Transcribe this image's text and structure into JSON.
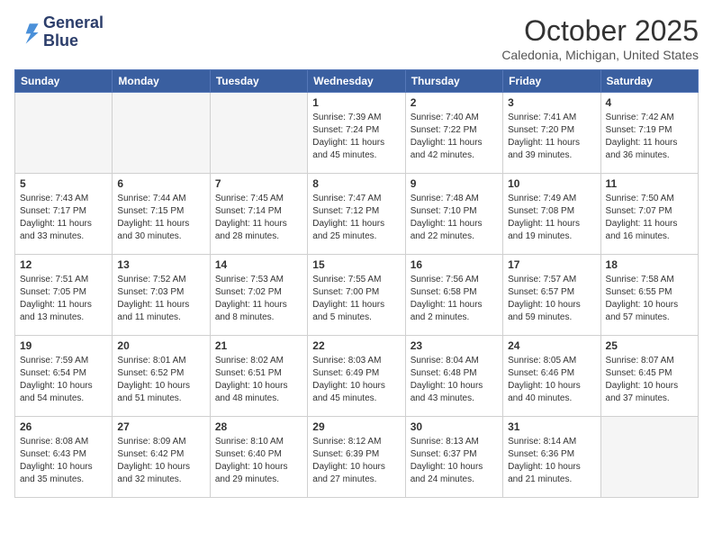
{
  "header": {
    "logo_line1": "General",
    "logo_line2": "Blue",
    "month": "October 2025",
    "location": "Caledonia, Michigan, United States"
  },
  "weekdays": [
    "Sunday",
    "Monday",
    "Tuesday",
    "Wednesday",
    "Thursday",
    "Friday",
    "Saturday"
  ],
  "weeks": [
    [
      {
        "day": "",
        "sunrise": "",
        "sunset": "",
        "daylight": ""
      },
      {
        "day": "",
        "sunrise": "",
        "sunset": "",
        "daylight": ""
      },
      {
        "day": "",
        "sunrise": "",
        "sunset": "",
        "daylight": ""
      },
      {
        "day": "1",
        "sunrise": "Sunrise: 7:39 AM",
        "sunset": "Sunset: 7:24 PM",
        "daylight": "Daylight: 11 hours and 45 minutes."
      },
      {
        "day": "2",
        "sunrise": "Sunrise: 7:40 AM",
        "sunset": "Sunset: 7:22 PM",
        "daylight": "Daylight: 11 hours and 42 minutes."
      },
      {
        "day": "3",
        "sunrise": "Sunrise: 7:41 AM",
        "sunset": "Sunset: 7:20 PM",
        "daylight": "Daylight: 11 hours and 39 minutes."
      },
      {
        "day": "4",
        "sunrise": "Sunrise: 7:42 AM",
        "sunset": "Sunset: 7:19 PM",
        "daylight": "Daylight: 11 hours and 36 minutes."
      }
    ],
    [
      {
        "day": "5",
        "sunrise": "Sunrise: 7:43 AM",
        "sunset": "Sunset: 7:17 PM",
        "daylight": "Daylight: 11 hours and 33 minutes."
      },
      {
        "day": "6",
        "sunrise": "Sunrise: 7:44 AM",
        "sunset": "Sunset: 7:15 PM",
        "daylight": "Daylight: 11 hours and 30 minutes."
      },
      {
        "day": "7",
        "sunrise": "Sunrise: 7:45 AM",
        "sunset": "Sunset: 7:14 PM",
        "daylight": "Daylight: 11 hours and 28 minutes."
      },
      {
        "day": "8",
        "sunrise": "Sunrise: 7:47 AM",
        "sunset": "Sunset: 7:12 PM",
        "daylight": "Daylight: 11 hours and 25 minutes."
      },
      {
        "day": "9",
        "sunrise": "Sunrise: 7:48 AM",
        "sunset": "Sunset: 7:10 PM",
        "daylight": "Daylight: 11 hours and 22 minutes."
      },
      {
        "day": "10",
        "sunrise": "Sunrise: 7:49 AM",
        "sunset": "Sunset: 7:08 PM",
        "daylight": "Daylight: 11 hours and 19 minutes."
      },
      {
        "day": "11",
        "sunrise": "Sunrise: 7:50 AM",
        "sunset": "Sunset: 7:07 PM",
        "daylight": "Daylight: 11 hours and 16 minutes."
      }
    ],
    [
      {
        "day": "12",
        "sunrise": "Sunrise: 7:51 AM",
        "sunset": "Sunset: 7:05 PM",
        "daylight": "Daylight: 11 hours and 13 minutes."
      },
      {
        "day": "13",
        "sunrise": "Sunrise: 7:52 AM",
        "sunset": "Sunset: 7:03 PM",
        "daylight": "Daylight: 11 hours and 11 minutes."
      },
      {
        "day": "14",
        "sunrise": "Sunrise: 7:53 AM",
        "sunset": "Sunset: 7:02 PM",
        "daylight": "Daylight: 11 hours and 8 minutes."
      },
      {
        "day": "15",
        "sunrise": "Sunrise: 7:55 AM",
        "sunset": "Sunset: 7:00 PM",
        "daylight": "Daylight: 11 hours and 5 minutes."
      },
      {
        "day": "16",
        "sunrise": "Sunrise: 7:56 AM",
        "sunset": "Sunset: 6:58 PM",
        "daylight": "Daylight: 11 hours and 2 minutes."
      },
      {
        "day": "17",
        "sunrise": "Sunrise: 7:57 AM",
        "sunset": "Sunset: 6:57 PM",
        "daylight": "Daylight: 10 hours and 59 minutes."
      },
      {
        "day": "18",
        "sunrise": "Sunrise: 7:58 AM",
        "sunset": "Sunset: 6:55 PM",
        "daylight": "Daylight: 10 hours and 57 minutes."
      }
    ],
    [
      {
        "day": "19",
        "sunrise": "Sunrise: 7:59 AM",
        "sunset": "Sunset: 6:54 PM",
        "daylight": "Daylight: 10 hours and 54 minutes."
      },
      {
        "day": "20",
        "sunrise": "Sunrise: 8:01 AM",
        "sunset": "Sunset: 6:52 PM",
        "daylight": "Daylight: 10 hours and 51 minutes."
      },
      {
        "day": "21",
        "sunrise": "Sunrise: 8:02 AM",
        "sunset": "Sunset: 6:51 PM",
        "daylight": "Daylight: 10 hours and 48 minutes."
      },
      {
        "day": "22",
        "sunrise": "Sunrise: 8:03 AM",
        "sunset": "Sunset: 6:49 PM",
        "daylight": "Daylight: 10 hours and 45 minutes."
      },
      {
        "day": "23",
        "sunrise": "Sunrise: 8:04 AM",
        "sunset": "Sunset: 6:48 PM",
        "daylight": "Daylight: 10 hours and 43 minutes."
      },
      {
        "day": "24",
        "sunrise": "Sunrise: 8:05 AM",
        "sunset": "Sunset: 6:46 PM",
        "daylight": "Daylight: 10 hours and 40 minutes."
      },
      {
        "day": "25",
        "sunrise": "Sunrise: 8:07 AM",
        "sunset": "Sunset: 6:45 PM",
        "daylight": "Daylight: 10 hours and 37 minutes."
      }
    ],
    [
      {
        "day": "26",
        "sunrise": "Sunrise: 8:08 AM",
        "sunset": "Sunset: 6:43 PM",
        "daylight": "Daylight: 10 hours and 35 minutes."
      },
      {
        "day": "27",
        "sunrise": "Sunrise: 8:09 AM",
        "sunset": "Sunset: 6:42 PM",
        "daylight": "Daylight: 10 hours and 32 minutes."
      },
      {
        "day": "28",
        "sunrise": "Sunrise: 8:10 AM",
        "sunset": "Sunset: 6:40 PM",
        "daylight": "Daylight: 10 hours and 29 minutes."
      },
      {
        "day": "29",
        "sunrise": "Sunrise: 8:12 AM",
        "sunset": "Sunset: 6:39 PM",
        "daylight": "Daylight: 10 hours and 27 minutes."
      },
      {
        "day": "30",
        "sunrise": "Sunrise: 8:13 AM",
        "sunset": "Sunset: 6:37 PM",
        "daylight": "Daylight: 10 hours and 24 minutes."
      },
      {
        "day": "31",
        "sunrise": "Sunrise: 8:14 AM",
        "sunset": "Sunset: 6:36 PM",
        "daylight": "Daylight: 10 hours and 21 minutes."
      },
      {
        "day": "",
        "sunrise": "",
        "sunset": "",
        "daylight": ""
      }
    ]
  ]
}
